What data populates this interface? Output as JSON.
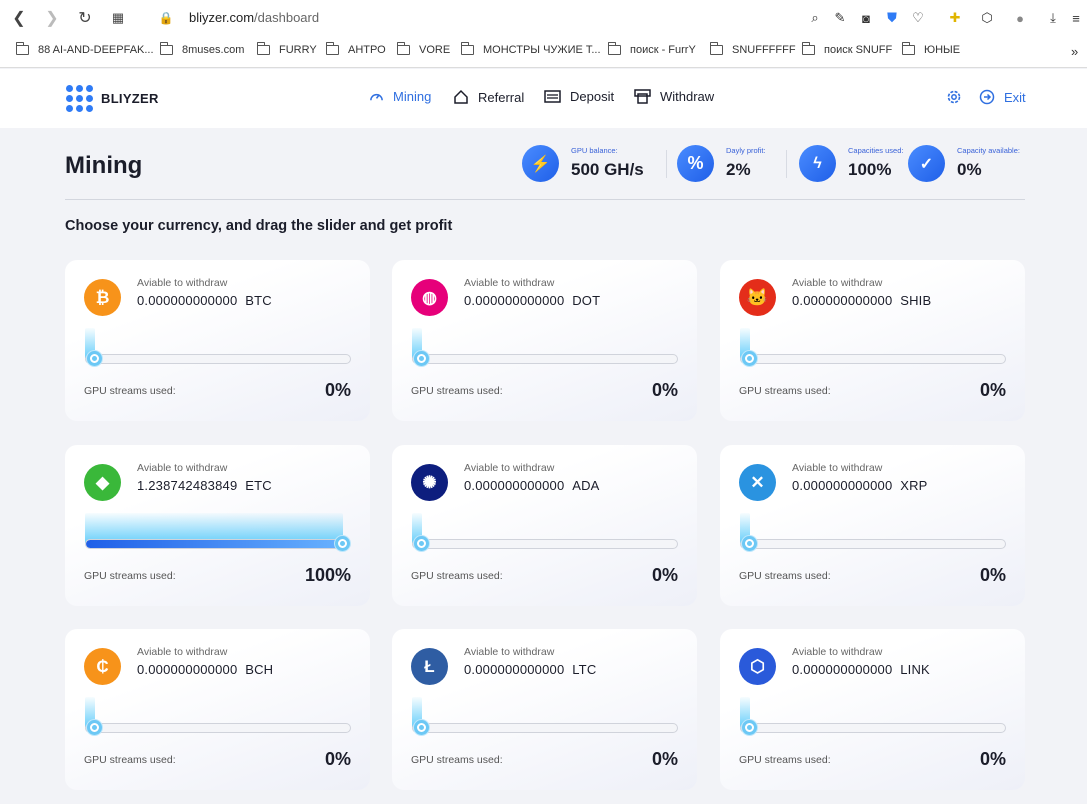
{
  "browser": {
    "url_host": "bliyzer.com",
    "url_path": "/dashboard"
  },
  "bookmarks": [
    {
      "label": "88 AI-AND-DEEPFAK..."
    },
    {
      "label": "8muses.com"
    },
    {
      "label": "FURRY"
    },
    {
      "label": "АНТРО"
    },
    {
      "label": "VORE"
    },
    {
      "label": "МОНСТРЫ ЧУЖИЕ Т..."
    },
    {
      "label": "поиск - FurrY"
    },
    {
      "label": "SNUFFFFFF"
    },
    {
      "label": "поиск SNUFF"
    },
    {
      "label": "ЮНЫЕ"
    }
  ],
  "header": {
    "logo_text": "BLIYZER",
    "nav": [
      {
        "label": "Mining",
        "icon": "gauge-icon",
        "active": true
      },
      {
        "label": "Referral",
        "icon": "home-icon"
      },
      {
        "label": "Deposit",
        "icon": "wallet-icon"
      },
      {
        "label": "Withdraw",
        "icon": "atm-icon"
      }
    ],
    "exit_label": "Exit"
  },
  "main": {
    "title": "Mining",
    "subtitle": "Choose your currency, and drag the slider and get profit",
    "stats": [
      {
        "label": "GPU balance:",
        "value": "500 GH/s",
        "icon": "battery-charge-icon"
      },
      {
        "label": "Dayly profit:",
        "value": "2%",
        "icon": "percent-icon"
      },
      {
        "label": "Capacities used:",
        "value": "100%",
        "icon": "lightning-icon"
      },
      {
        "label": "Capacity available:",
        "value": "0%",
        "icon": "check-circle-icon"
      }
    ],
    "cards": [
      {
        "coin": "BTC",
        "avail_label": "Aviable to withdraw",
        "amount": "0.000000000000",
        "streams_label": "GPU streams used:",
        "percent_text": "0%",
        "percent": 0,
        "color": "#f7931a",
        "glyph": "₿"
      },
      {
        "coin": "DOT",
        "avail_label": "Aviable to withdraw",
        "amount": "0.000000000000",
        "streams_label": "GPU streams used:",
        "percent_text": "0%",
        "percent": 0,
        "color": "#e6007a",
        "glyph": "◍"
      },
      {
        "coin": "SHIB",
        "avail_label": "Aviable to withdraw",
        "amount": "0.000000000000",
        "streams_label": "GPU streams used:",
        "percent_text": "0%",
        "percent": 0,
        "color": "#e42d1a",
        "glyph": "🐱"
      },
      {
        "coin": "ETC",
        "avail_label": "Aviable to withdraw",
        "amount": "1.238742483849",
        "streams_label": "GPU streams used:",
        "percent_text": "100%",
        "percent": 100,
        "color": "#3ab83a",
        "glyph": "◆"
      },
      {
        "coin": "ADA",
        "avail_label": "Aviable to withdraw",
        "amount": "0.000000000000",
        "streams_label": "GPU streams used:",
        "percent_text": "0%",
        "percent": 0,
        "color": "#0d1e7e",
        "glyph": "✺"
      },
      {
        "coin": "XRP",
        "avail_label": "Aviable to withdraw",
        "amount": "0.000000000000",
        "streams_label": "GPU streams used:",
        "percent_text": "0%",
        "percent": 0,
        "color": "#2a93e0",
        "glyph": "✕"
      },
      {
        "coin": "BCH",
        "avail_label": "Aviable to withdraw",
        "amount": "0.000000000000",
        "streams_label": "GPU streams used:",
        "percent_text": "0%",
        "percent": 0,
        "color": "#f7931a",
        "glyph": "₵"
      },
      {
        "coin": "LTC",
        "avail_label": "Aviable to withdraw",
        "amount": "0.000000000000",
        "streams_label": "GPU streams used:",
        "percent_text": "0%",
        "percent": 0,
        "color": "#2f5da3",
        "glyph": "Ł"
      },
      {
        "coin": "LINK",
        "avail_label": "Aviable to withdraw",
        "amount": "0.000000000000",
        "streams_label": "GPU streams used:",
        "percent_text": "0%",
        "percent": 0,
        "color": "#2a5ada",
        "glyph": "⬡"
      }
    ]
  }
}
